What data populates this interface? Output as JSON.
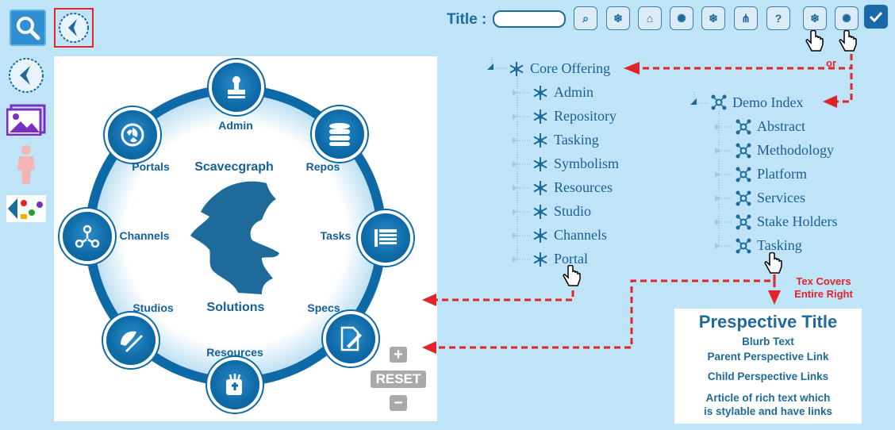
{
  "toolbar": {
    "title_label": "Title :",
    "title_value": "",
    "buttons": [
      {
        "icon": "search-icon",
        "glyph": "⌕"
      },
      {
        "icon": "snowflake-network-icon",
        "glyph": "❄"
      },
      {
        "icon": "home-icon",
        "glyph": "⌂"
      },
      {
        "icon": "hub-network-icon",
        "glyph": "✺"
      },
      {
        "icon": "snowflake-network-icon",
        "glyph": "❄"
      },
      {
        "icon": "tree-network-icon",
        "glyph": "⋔"
      },
      {
        "icon": "help-icon",
        "glyph": "?"
      },
      {
        "icon": "snowflake-network-icon",
        "glyph": "❄"
      },
      {
        "icon": "hub-network-icon",
        "glyph": "✺"
      }
    ],
    "ok_icon": "checkmark-icon"
  },
  "left_sidebar": {
    "icons": [
      "logo-icon",
      "gallery-icon",
      "person-figure-icon",
      "collage-thumbnail-icon"
    ]
  },
  "wheel": {
    "center_title": "Scavecgraph",
    "center_subtitle": "Solutions",
    "items": [
      {
        "label": "Admin",
        "icon": "stamp-icon"
      },
      {
        "label": "Repos",
        "icon": "database-icon"
      },
      {
        "label": "Tasks",
        "icon": "task-list-icon"
      },
      {
        "label": "Specs",
        "icon": "document-pen-icon"
      },
      {
        "label": "Resources",
        "icon": "resources-icon"
      },
      {
        "label": "Studios",
        "icon": "studio-icon"
      },
      {
        "label": "Channels",
        "icon": "channels-icon"
      },
      {
        "label": "Portals",
        "icon": "portal-icon"
      }
    ],
    "zoom_in": "+",
    "reset": "RESET",
    "zoom_out": "−"
  },
  "tree_core": {
    "root": "Core Offering",
    "children": [
      "Admin",
      "Repository",
      "Tasking",
      "Symbolism",
      "Resources",
      "Studio",
      "Channels",
      "Portal"
    ]
  },
  "tree_demo": {
    "root": "Demo Index",
    "children": [
      "Abstract",
      "Methodology",
      "Platform",
      "Services",
      "Stake Holders",
      "Tasking"
    ]
  },
  "annotations": {
    "or": "or",
    "tex_covers_line1": "Tex Covers",
    "tex_covers_line2": "Entire Right"
  },
  "article": {
    "title": "Prespective Title",
    "blurb": "Blurb Text",
    "parent_link": "Parent Perspective Link",
    "child_links": "Child Perspective Links",
    "rich_text_line1": "Article of rich text which",
    "rich_text_line2": "is stylable and have links"
  },
  "colors": {
    "background": "#bfe4f7",
    "primary": "#0e6aa6",
    "text_blue": "#1d5f93",
    "arrow_red": "#e0242a"
  }
}
